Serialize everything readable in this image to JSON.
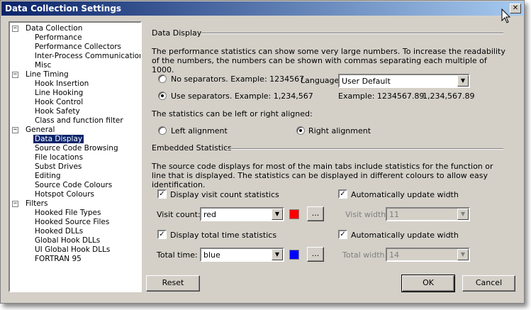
{
  "window": {
    "title": "Data Collection Settings",
    "close_glyph": "✕"
  },
  "tree": [
    {
      "label": "Data Collection",
      "level": 0,
      "expander": "−"
    },
    {
      "label": "Performance",
      "level": 1
    },
    {
      "label": "Performance Collectors",
      "level": 1
    },
    {
      "label": "Inter-Process Communications",
      "level": 1
    },
    {
      "label": "Misc",
      "level": 1
    },
    {
      "label": "Line Timing",
      "level": 0,
      "expander": "−"
    },
    {
      "label": "Hook Insertion",
      "level": 1
    },
    {
      "label": "Line Hooking",
      "level": 1
    },
    {
      "label": "Hook Control",
      "level": 1
    },
    {
      "label": "Hook Safety",
      "level": 1
    },
    {
      "label": "Class and function filter",
      "level": 1
    },
    {
      "label": "General",
      "level": 0,
      "expander": "−"
    },
    {
      "label": "Data Display",
      "level": 1,
      "selected": true
    },
    {
      "label": "Source Code Browsing",
      "level": 1
    },
    {
      "label": "File locations",
      "level": 1
    },
    {
      "label": "Subst Drives",
      "level": 1
    },
    {
      "label": "Editing",
      "level": 1
    },
    {
      "label": "Source Code Colours",
      "level": 1
    },
    {
      "label": "Hotspot Colours",
      "level": 1
    },
    {
      "label": "Filters",
      "level": 0,
      "expander": "−"
    },
    {
      "label": "Hooked File Types",
      "level": 1
    },
    {
      "label": "Hooked Source Files",
      "level": 1
    },
    {
      "label": "Hooked DLLs",
      "level": 1
    },
    {
      "label": "Global Hook DLLs",
      "level": 1
    },
    {
      "label": "UI Global Hook DLLs",
      "level": 1
    },
    {
      "label": "FORTRAN 95",
      "level": 1
    }
  ],
  "data_display": {
    "section_title": "Data Display",
    "description": "The performance statistics can show some very large numbers. To increase the readability of the numbers, the numbers can be shown with commas separating each multiple of 1000.",
    "no_sep_label": "No separators. Example: 1234567",
    "use_sep_label": "Use separators. Example: 1,234,567",
    "separator_choice": "use",
    "language_label": "Language:",
    "language_value": "User Default",
    "example_prefix": "Example: 1234567.89",
    "example_value": "1,234,567.89",
    "align_text": "The statistics can be left or right aligned:",
    "left_align_label": "Left alignment",
    "right_align_label": "Right alignment",
    "alignment_choice": "right"
  },
  "embedded": {
    "section_title": "Embedded Statistics",
    "description": "The source code displays for most of the main tabs include statistics for the function or line that is displayed. The statistics can be displayed in different colours to allow easy identification.",
    "visit_check_label": "Display visit count statistics",
    "visit_checked": true,
    "visit_auto_label": "Automatically update width",
    "visit_auto_checked": true,
    "visit_count_label": "Visit count:",
    "visit_color_value": "red",
    "visit_color_hex": "#ff0000",
    "visit_width_label": "Visit width:",
    "visit_width_value": "11",
    "total_check_label": "Display total time statistics",
    "total_checked": true,
    "total_auto_label": "Automatically update width",
    "total_auto_checked": true,
    "total_time_label": "Total time:",
    "total_color_value": "blue",
    "total_color_hex": "#0000ff",
    "total_width_label": "Total width:",
    "total_width_value": "14",
    "ellipsis": "..."
  },
  "buttons": {
    "reset": "Reset",
    "ok": "OK",
    "cancel": "Cancel"
  },
  "glyphs": {
    "check": "✓",
    "dropdown": "▼"
  }
}
